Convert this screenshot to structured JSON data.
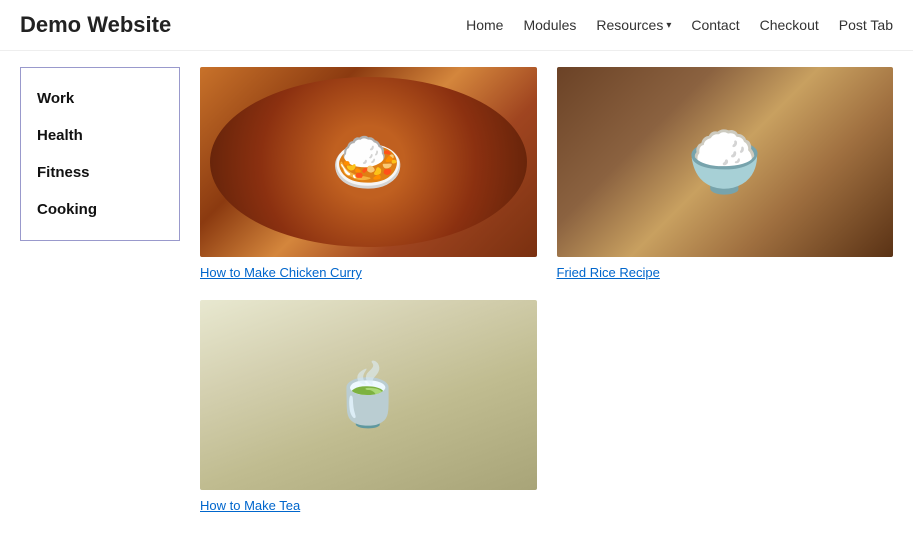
{
  "header": {
    "site_title": "Demo Website",
    "nav": {
      "home": "Home",
      "modules": "Modules",
      "resources": "Resources",
      "contact": "Contact",
      "checkout": "Checkout",
      "post_tab": "Post Tab"
    }
  },
  "sidebar": {
    "items": [
      {
        "label": "Work"
      },
      {
        "label": "Health"
      },
      {
        "label": "Fitness"
      },
      {
        "label": "Cooking"
      }
    ]
  },
  "posts": {
    "column1": [
      {
        "id": "chicken-curry",
        "link_text": "How to Make Chicken Curry",
        "image_alt": "Chicken Curry"
      },
      {
        "id": "tea",
        "link_text": "How to Make Tea",
        "image_alt": "Tea"
      }
    ],
    "column2": [
      {
        "id": "fried-rice",
        "link_text": "Fried Rice Recipe",
        "image_alt": "Fried Rice"
      }
    ]
  }
}
